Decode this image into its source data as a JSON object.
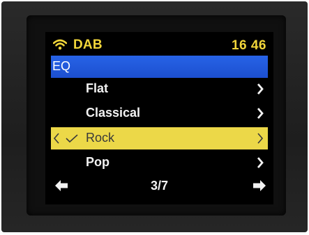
{
  "status": {
    "source": "DAB",
    "time": "16 46",
    "accent_color": "#f2d63a"
  },
  "menu": {
    "title": "EQ",
    "header_color": "#2763e6",
    "items": [
      {
        "label": "Flat",
        "selected": false
      },
      {
        "label": "Classical",
        "selected": false
      },
      {
        "label": "Rock",
        "selected": true
      },
      {
        "label": "Pop",
        "selected": false
      }
    ],
    "selected_color": "#ecd848"
  },
  "footer": {
    "page": "3/7",
    "left_icon": "left-arrow-icon",
    "right_icon": "right-arrow-icon"
  },
  "icons": {
    "signal": "wifi-icon",
    "check": "check-icon",
    "chevron": "chevron-right-icon"
  }
}
